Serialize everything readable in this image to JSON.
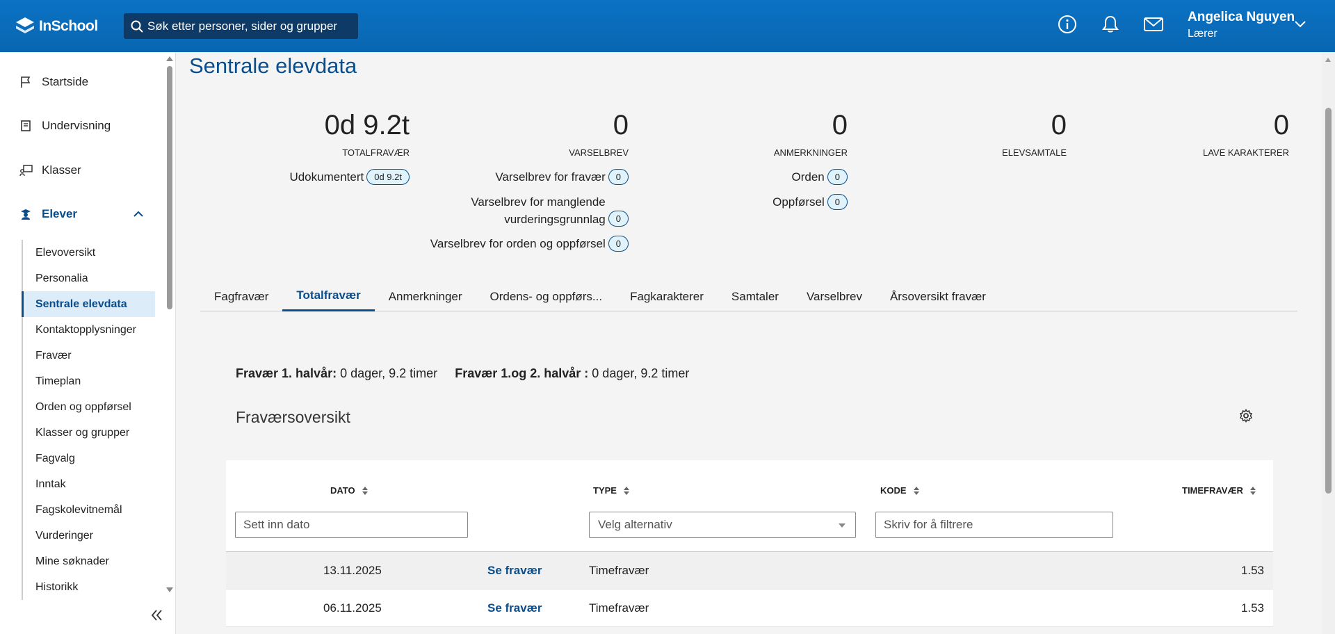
{
  "app": {
    "logo_text": "InSchool"
  },
  "search": {
    "placeholder": "Søk etter personer, sider og grupper"
  },
  "user": {
    "name": "Angelica Nguyen",
    "role": "Lærer"
  },
  "sidebar": {
    "items": [
      {
        "label": "Startside",
        "icon": "flag-icon"
      },
      {
        "label": "Undervisning",
        "icon": "book-icon"
      },
      {
        "label": "Klasser",
        "icon": "classroom-icon"
      },
      {
        "label": "Elever",
        "icon": "student-icon"
      }
    ],
    "subitems": [
      "Elevoversikt",
      "Personalia",
      "Sentrale elevdata",
      "Kontaktopplysninger",
      "Fravær",
      "Timeplan",
      "Orden og oppførsel",
      "Klasser og grupper",
      "Fagvalg",
      "Inntak",
      "Fagskolevitnemål",
      "Vurderinger",
      "Mine søknader",
      "Historikk"
    ],
    "active_subitem": "Sentrale elevdata"
  },
  "page": {
    "title": "Sentrale elevdata"
  },
  "stats": {
    "totalfravaer": {
      "value": "0d 9.2t",
      "label": "TOTALFRAVÆR",
      "rows": [
        {
          "label": "Udokumentert",
          "value": "0d 9.2t"
        }
      ]
    },
    "varselbrev": {
      "value": "0",
      "label": "VARSELBREV",
      "rows": [
        {
          "label": "Varselbrev for fravær",
          "value": "0"
        },
        {
          "label_line1": "Varselbrev for manglende",
          "label_line2": "vurderingsgrunnlag",
          "value": "0"
        },
        {
          "label": "Varselbrev for orden og oppførsel",
          "value": "0"
        }
      ]
    },
    "anmerkninger": {
      "value": "0",
      "label": "ANMERKNINGER",
      "rows": [
        {
          "label": "Orden",
          "value": "0"
        },
        {
          "label": "Oppførsel",
          "value": "0"
        }
      ]
    },
    "elevsamtale": {
      "value": "0",
      "label": "ELEVSAMTALE"
    },
    "lave_karakterer": {
      "value": "0",
      "label": "LAVE KARAKTERER"
    }
  },
  "tabs": [
    {
      "label": "Fagfravær"
    },
    {
      "label": "Totalfravær",
      "active": true
    },
    {
      "label": "Anmerkninger"
    },
    {
      "label": "Ordens- og oppførs..."
    },
    {
      "label": "Fagkarakterer"
    },
    {
      "label": "Samtaler"
    },
    {
      "label": "Varselbrev"
    },
    {
      "label": "Årsoversikt fravær"
    }
  ],
  "summary": {
    "first_label": "Fravær 1. halvår:",
    "first_value": "0 dager, 9.2 timer",
    "both_label": "Fravær 1.og 2. halvår :",
    "both_value": "0 dager, 9.2 timer"
  },
  "section": {
    "title": "Fraværsoversikt"
  },
  "table": {
    "columns": [
      "DATO",
      "TYPE",
      "KODE",
      "TIMEFRAVÆR"
    ],
    "filters": {
      "date_placeholder": "Sett inn dato",
      "type_placeholder": "Velg alternativ",
      "code_placeholder": "Skriv for å filtrere"
    },
    "rows": [
      {
        "date": "13.11.2025",
        "link": "Se fravær",
        "type": "Timefravær",
        "code": "",
        "hours": "1.53"
      },
      {
        "date": "06.11.2025",
        "link": "Se fravær",
        "type": "Timefravær",
        "code": "",
        "hours": "1.53"
      }
    ]
  }
}
